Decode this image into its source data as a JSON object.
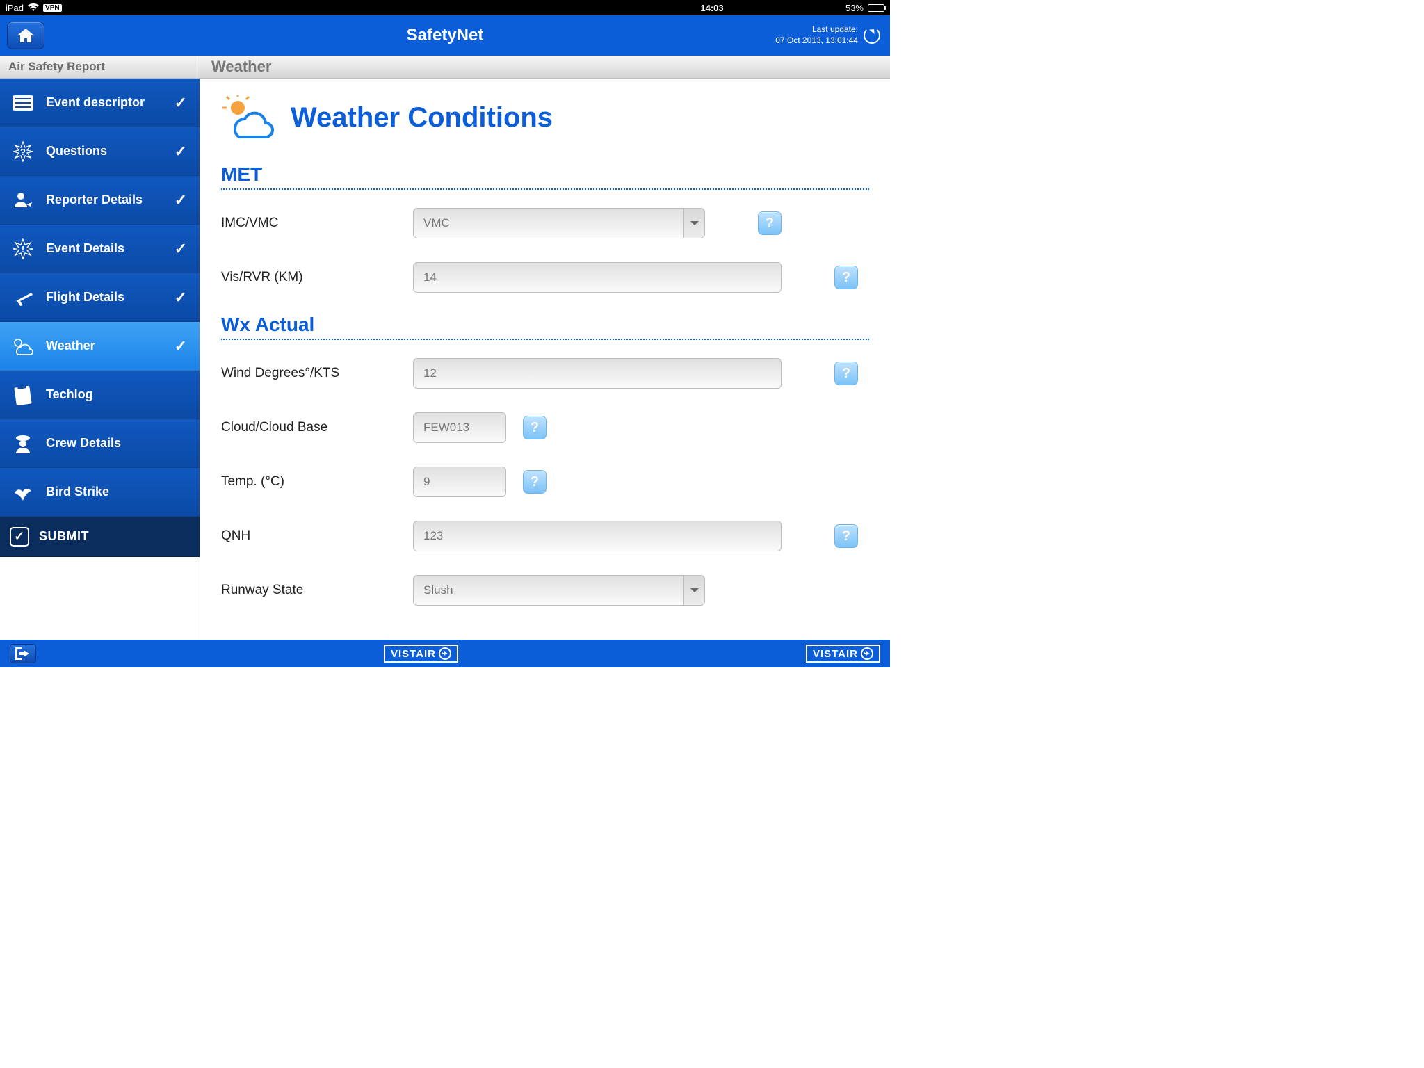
{
  "statusbar": {
    "device": "iPad",
    "vpn": "VPN",
    "time": "14:03",
    "battery_pct": "53%"
  },
  "header": {
    "title": "SafetyNet",
    "last_update_label": "Last update:",
    "last_update_value": "07 Oct 2013, 13:01:44"
  },
  "sidebar": {
    "title": "Air Safety Report",
    "items": [
      {
        "label": "Event descriptor",
        "done": true
      },
      {
        "label": "Questions",
        "done": true
      },
      {
        "label": "Reporter Details",
        "done": true
      },
      {
        "label": "Event Details",
        "done": true
      },
      {
        "label": "Flight Details",
        "done": true
      },
      {
        "label": "Weather",
        "done": true,
        "active": true
      },
      {
        "label": "Techlog",
        "done": false
      },
      {
        "label": "Crew Details",
        "done": false
      },
      {
        "label": "Bird Strike",
        "done": false
      }
    ],
    "submit_label": "SUBMIT"
  },
  "main": {
    "section_title": "Weather",
    "hero_title": "Weather Conditions",
    "groups": {
      "met": {
        "title": "MET",
        "imc_vmc": {
          "label": "IMC/VMC",
          "value": "VMC"
        },
        "vis_rvr": {
          "label": "Vis/RVR (KM)",
          "value": "14"
        }
      },
      "wx": {
        "title": "Wx Actual",
        "wind": {
          "label": "Wind Degrees°/KTS",
          "value": "12"
        },
        "cloud": {
          "label": "Cloud/Cloud Base",
          "value": "FEW013"
        },
        "temp": {
          "label": "Temp. (°C)",
          "value": "9"
        },
        "qnh": {
          "label": "QNH",
          "value": "123"
        },
        "rwy": {
          "label": "Runway State",
          "value": "Slush"
        }
      }
    }
  },
  "footer": {
    "brand": "VISTAIR"
  }
}
